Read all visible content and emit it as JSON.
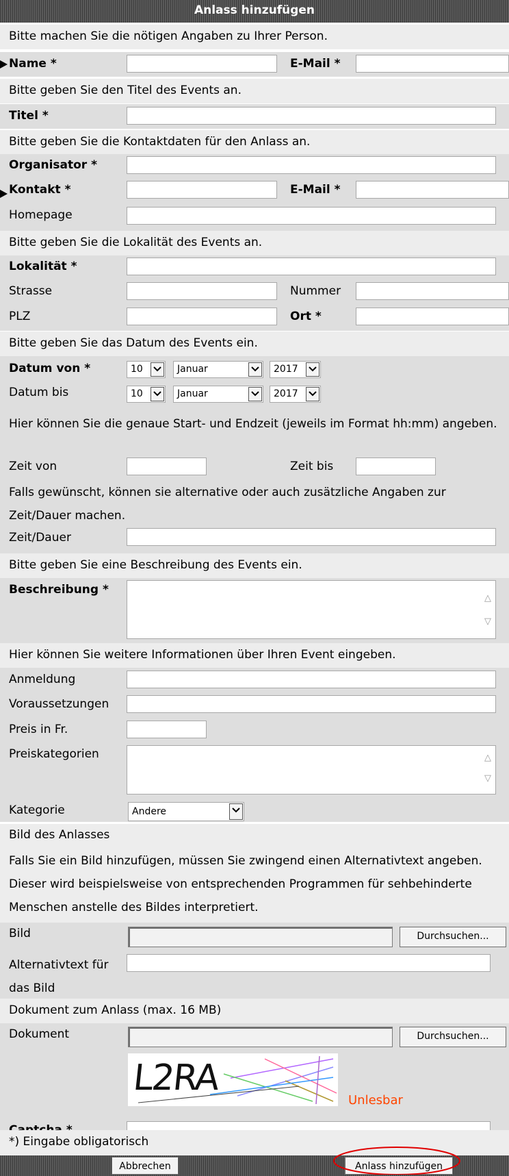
{
  "title": "Anlass hinzufügen",
  "person": {
    "intro": "Bitte machen Sie die nötigen Angaben zu Ihrer Person.",
    "name_label": "Name *",
    "email_label": "E-Mail *"
  },
  "event": {
    "intro": "Bitte geben Sie den Titel des Events an.",
    "titel_label": "Titel *"
  },
  "contact": {
    "intro": "Bitte geben Sie die Kontaktdaten für den Anlass an.",
    "organisator_label": "Organisator *",
    "kontakt_label": "Kontakt *",
    "email_label": "E-Mail *",
    "homepage_label": "Homepage"
  },
  "location": {
    "intro": "Bitte geben Sie die Lokalität des Events an.",
    "lokalitaet_label": "Lokalität *",
    "strasse_label": "Strasse",
    "nummer_label": "Nummer",
    "plz_label": "PLZ",
    "ort_label": "Ort *"
  },
  "date": {
    "intro": "Bitte geben Sie das Datum des Events ein.",
    "von_label": "Datum von *",
    "bis_label": "Datum bis",
    "von": {
      "day": "10",
      "month": "Januar",
      "year": "2017"
    },
    "bis": {
      "day": "10",
      "month": "Januar",
      "year": "2017"
    }
  },
  "time": {
    "intro": "Hier können Sie die genaue Start- und Endzeit (jeweils im Format hh:mm) angeben.",
    "von_label": "Zeit von",
    "bis_label": "Zeit bis",
    "duration_intro": "Falls gewünscht, können sie alternative oder auch zusätzliche Angaben zur Zeit/Dauer machen.",
    "duration_label": "Zeit/Dauer"
  },
  "description": {
    "intro": "Bitte geben Sie eine Beschreibung des Events ein.",
    "label": "Beschreibung *"
  },
  "more": {
    "intro": "Hier können Sie weitere Informationen über Ihren Event eingeben.",
    "anmeldung_label": "Anmeldung",
    "voraussetzungen_label": "Voraussetzungen",
    "preis_label": "Preis in Fr.",
    "preiskategorien_label": "Preiskategorien",
    "kategorie_label": "Kategorie",
    "kategorie_value": "Andere"
  },
  "image": {
    "heading": "Bild des Anlasses",
    "intro": "Falls Sie ein Bild hinzufügen, müssen Sie zwingend einen Alternativtext angeben. Dieser wird beispielsweise von entsprechenden Programmen für sehbehinderte Menschen anstelle des Bildes interpretiert.",
    "bild_label": "Bild",
    "browse_label": "Durchsuchen...",
    "alt_label": "Alternativtext für das Bild"
  },
  "document": {
    "heading": "Dokument zum Anlass (max. 16 MB)",
    "label": "Dokument",
    "browse_label": "Durchsuchen..."
  },
  "captcha": {
    "text": "L2RA",
    "unreadable_link": "Unlesbar",
    "label": "Captcha *",
    "link_color": "#ff4500"
  },
  "footer": {
    "note": "*) Eingabe obligatorisch",
    "cancel_label": "Abbrechen",
    "submit_label": "Anlass hinzufügen"
  },
  "colors": {
    "header_bg": "#4a4a4a",
    "row_grey": "#dedede",
    "info_grey": "#ededed",
    "highlight_circle": "#e00000"
  }
}
